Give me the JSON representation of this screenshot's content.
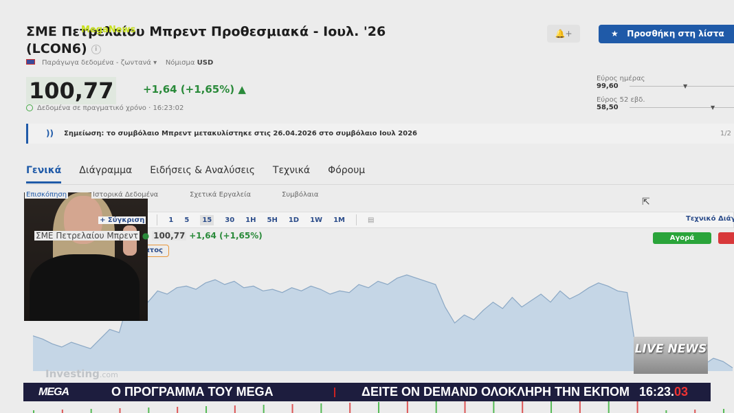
{
  "header": {
    "title_line1": "ΣΜΕ Πετρελαίου Μπρεντ Προθεσμιακά - Ιουλ. '26",
    "title_line2": "(LCON6)",
    "watermark": "MegaNews",
    "data_source": "Παράγωγα δεδομένα - ζωντανά",
    "currency_label": "Νόμισμα",
    "currency": "USD",
    "alert_icon": "bell-plus-icon",
    "watchlist_label": "Προσθήκη στη λίστα"
  },
  "quote": {
    "price": "100,77",
    "change": "+1,64 (+1,65%)",
    "realtime": "Δεδομένα σε πραγματικό χρόνο · 16:23:02"
  },
  "ranges": [
    {
      "label": "Εύρος ημέρας",
      "low": "99,60",
      "position": 0.45
    },
    {
      "label": "Εύρος 52 εβδ.",
      "low": "58,50",
      "position": 0.78
    }
  ],
  "note": {
    "text": "Σημείωση: το συμβόλαιο Μπρεντ μετακυλίστηκε στις 26.04.2026 στο συμβόλαιο Ιουλ 2026",
    "page": "1/2"
  },
  "tabs": [
    "Γενικά",
    "Διάγραμμα",
    "Ειδήσεις & Αναλύσεις",
    "Τεχνικά",
    "Φόρουμ"
  ],
  "subtabs": [
    "Επισκόπηση",
    "Ιστορικά Δεδομένα",
    "Σχετικά Εργαλεία",
    "Συμβόλαια"
  ],
  "toolbar": {
    "compare": "+ Σύγκριση",
    "intervals": [
      "1",
      "5",
      "15",
      "30",
      "1H",
      "5H",
      "1D",
      "1W",
      "1M"
    ],
    "selected": "15",
    "technical": "Τεχνικό Διάγραμμα"
  },
  "legend": {
    "name": "ΣΜΕ Πετρελαίου Μπρεντ",
    "price": "100,77",
    "change": "+1,64 (+1,65%)",
    "indicators": "Δείκτες διαγράμματος"
  },
  "actions": {
    "buy": "Αγορά"
  },
  "chart_data": {
    "type": "area",
    "title": "",
    "xlabel": "",
    "ylabel": "",
    "color": "#c5d6e6",
    "line_color": "#8aa7c4",
    "values": [
      62,
      60,
      57,
      55,
      58,
      56,
      54,
      60,
      66,
      64,
      85,
      95,
      83,
      90,
      88,
      92,
      93,
      91,
      95,
      97,
      94,
      96,
      92,
      93,
      90,
      91,
      89,
      92,
      90,
      93,
      91,
      88,
      90,
      89,
      94,
      92,
      96,
      94,
      98,
      100,
      98,
      96,
      94,
      80,
      70,
      75,
      72,
      78,
      83,
      79,
      86,
      80,
      84,
      88,
      83,
      90,
      85,
      88,
      92,
      95,
      93,
      90,
      89,
      50,
      48,
      50,
      46,
      49,
      45,
      47,
      44,
      48,
      46,
      42
    ]
  },
  "overlay": {
    "ticker_logo": "MEGA",
    "ticker_text1": "Ο ΠΡΟΓΡΑΜΜΑ ΤΟΥ MEGA",
    "ticker_text2": "ΔΕΙΤΕ ON DEMAND ΟΛΟΚΛΗΡΗ ΤΗΝ ΕΚΠΟΜΠΗ",
    "clock_hm": "16:23.",
    "clock_s": "03",
    "live_news": "LIVE NEWS",
    "chart_brand": "Investing",
    "chart_brand_suffix": ".com"
  }
}
